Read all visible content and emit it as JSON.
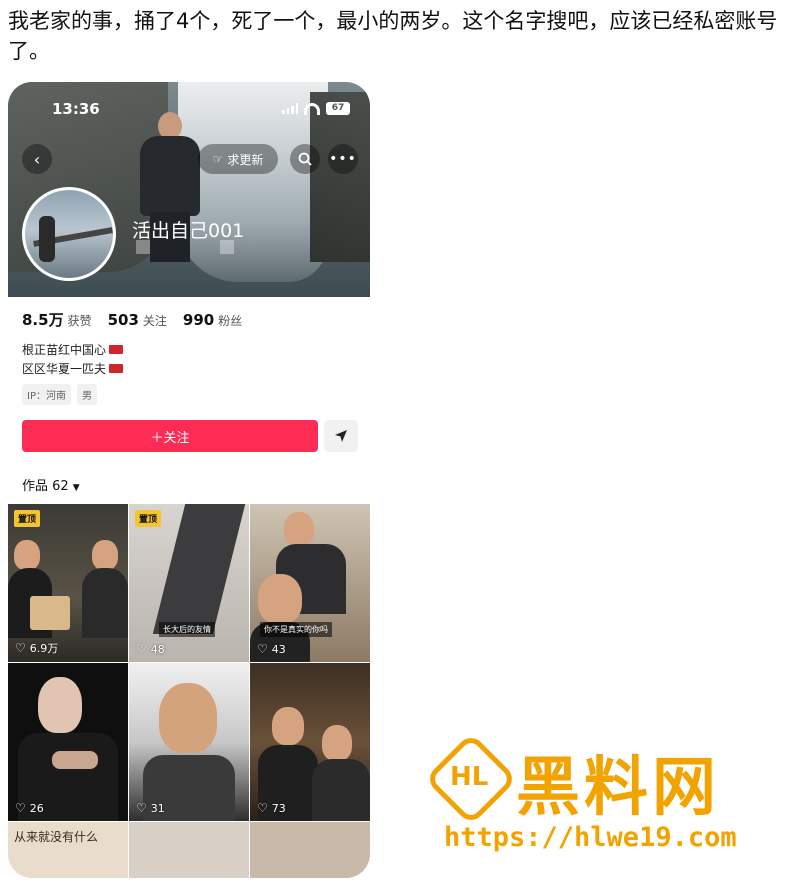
{
  "post": {
    "text": "我老家的事，捅了4个，死了一个，最小的两岁。这个名字搜吧，应该已经私密账号了。"
  },
  "phone": {
    "status_time": "13:36",
    "battery": "67",
    "update_button": "求更新",
    "nickname": "活出自己001",
    "stats": {
      "likes_num": "8.5万",
      "likes_label": "获赞",
      "following_num": "503",
      "following_label": "关注",
      "followers_num": "990",
      "followers_label": "粉丝"
    },
    "bio": [
      "根正苗红中国心",
      "区区华夏一匹夫"
    ],
    "tags": [
      "IP：河南",
      "男"
    ],
    "follow_button": "＋关注",
    "works_label": "作品 62",
    "grid": [
      {
        "pinned": "置顶",
        "likes": "6.9万"
      },
      {
        "pinned": "置顶",
        "likes": "48",
        "caption": "长大后的友情"
      },
      {
        "likes": "43",
        "caption": "你不是真实的你吗"
      },
      {
        "likes": "26"
      },
      {
        "likes": "31"
      },
      {
        "likes": "73"
      }
    ],
    "bottom_row_text": "从来就没有什么"
  },
  "watermark": {
    "logo": "HL",
    "title": "黑料网",
    "url": "https://hlwe19.com",
    "color": "#f2a300"
  },
  "colors": {
    "follow": "#fe2c55",
    "pin": "#f4c531"
  }
}
